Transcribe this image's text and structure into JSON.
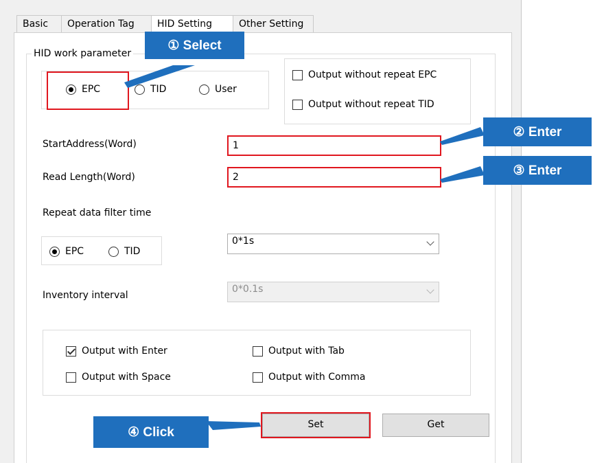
{
  "tabs": [
    "Basic",
    "Operation Tag",
    "HID Setting",
    "Other Setting"
  ],
  "hid_group": {
    "legend": "HID work parameter",
    "read_area": {
      "options": [
        "EPC",
        "TID",
        "User"
      ],
      "selected": "EPC"
    },
    "repeat_outputs": [
      {
        "label": "Output without repeat EPC",
        "checked": false
      },
      {
        "label": "Output without repeat TID",
        "checked": false
      }
    ],
    "start_address": {
      "label": "StartAddress(Word)",
      "value": "1"
    },
    "read_length": {
      "label": "Read Length(Word)",
      "value": "2"
    },
    "repeat_filter": {
      "label": "Repeat data filter time",
      "options": [
        "EPC",
        "TID"
      ],
      "selected": "EPC",
      "time_value": "0*1s"
    },
    "inventory_interval": {
      "label": "Inventory interval",
      "value": "0*0.1s",
      "disabled": true
    },
    "output_options": [
      {
        "label": "Output with Enter",
        "checked": true
      },
      {
        "label": "Output with Tab",
        "checked": false
      },
      {
        "label": "Output with Space",
        "checked": false
      },
      {
        "label": "Output with Comma",
        "checked": false
      }
    ],
    "set_button": "Set",
    "get_button": "Get"
  },
  "callouts": [
    "① Select",
    "② Enter",
    "③ Enter",
    "④ Click"
  ],
  "colors": {
    "callout": "#1f6fbd",
    "highlight": "#e0161e",
    "window": "#f0f0f0"
  },
  "icons": [
    "radio-icon",
    "checkbox-icon",
    "chevron-down-icon"
  ]
}
